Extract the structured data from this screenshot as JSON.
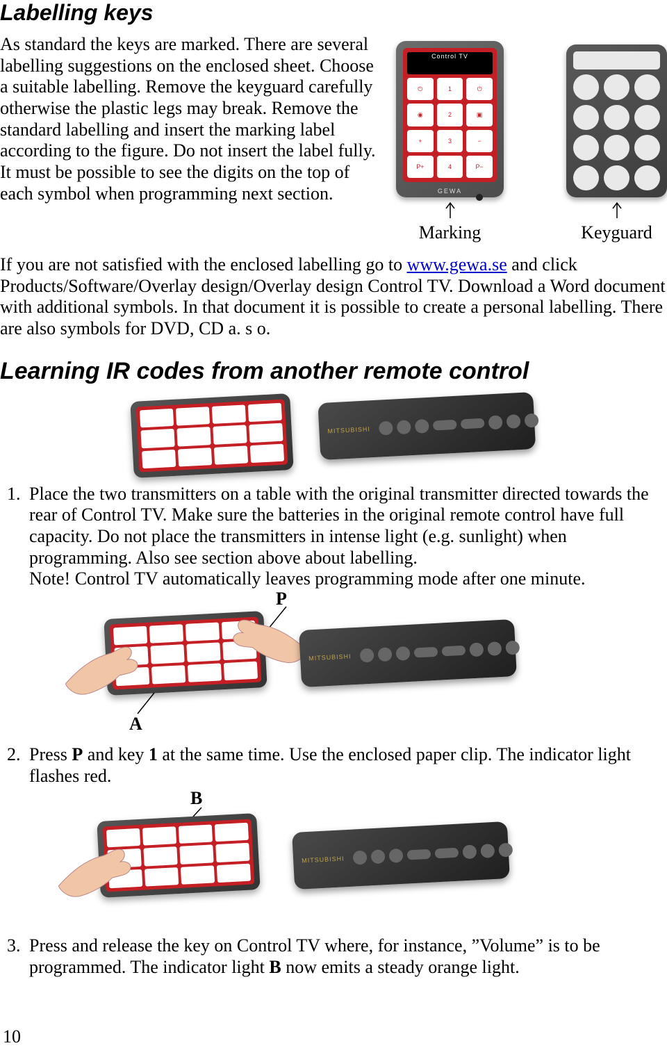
{
  "headings": {
    "labelling": "Labelling keys",
    "learning": "Learning IR codes from another remote control"
  },
  "paragraphs": {
    "intro": "As standard the keys are marked. There are several labelling suggestions on the enclosed sheet. Choose a suitable labelling. Remove the keyguard carefully otherwise the plastic legs may break. Remove the standard labelling and insert the marking label according to the figure. Do not insert the label fully. It must be possible to see the digits on the top of each symbol when programming next section.",
    "after_fig_pre": "If you are not satisfied with the enclosed labelling go to  ",
    "link_text": "www.gewa.se",
    "link_href": "http://www.gewa.se",
    "after_fig_post": " and click Products/Software/Overlay design/Overlay design Control TV. Download a Word document with additional symbols. In that document it is possible to create a personal labelling. There are also symbols for DVD, CD a. s o."
  },
  "figure1": {
    "left_label": "Marking",
    "right_label": "Keyguard",
    "device_title": "Control TV",
    "device_brand": "GEWA",
    "buttons": [
      "⏻",
      "1",
      "⏻",
      "◉",
      "2",
      "▣",
      "+",
      "3",
      "−",
      "P+",
      "4",
      "P−"
    ]
  },
  "steps": {
    "s1": "Place the two transmitters on a table with the original transmitter directed towards the rear of Control TV. Make sure the batteries in the original remote control have full capacity. Do not place the transmitters in intense light (e.g. sunlight) when programming. Also see section above about labelling.",
    "s1_note": "Note! Control TV automatically leaves programming mode after one minute.",
    "s2_pre": "Press ",
    "s2_b1": "P",
    "s2_mid": " and key ",
    "s2_b2": "1",
    "s2_post": " at the same time. Use the enclosed paper clip. The indicator light flashes red.",
    "s3_pre": "Press and release the key on Control TV where, for instance, ”Volume” is to be programmed. The indicator light ",
    "s3_b": "B",
    "s3_post": " now emits a steady orange light."
  },
  "labels": {
    "P": "P",
    "A": "A",
    "B": "B"
  },
  "remote_brand": "MITSUBISHI",
  "page_number": "10"
}
